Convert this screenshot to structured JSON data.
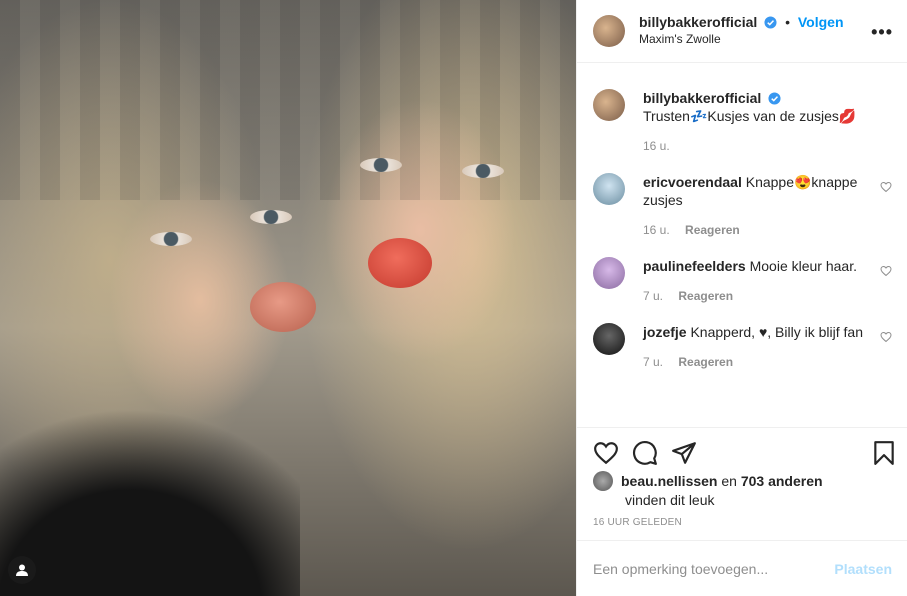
{
  "post": {
    "username": "billybakkerofficial",
    "dot": "•",
    "follow_label": "Volgen",
    "location": "Maxim's Zwolle",
    "more": "•••"
  },
  "caption": {
    "username": "billybakkerofficial",
    "text_before_emoji": "Trusten",
    "emoji_sleep": "💤",
    "text_after_emoji": "Kusjes van de zusjes",
    "emoji_kiss": "💋",
    "time": "16 u."
  },
  "comments": [
    {
      "username": "ericvoerendaal",
      "text": "Knappe😍knappe zusjes",
      "time": "16 u.",
      "reply": "Reageren"
    },
    {
      "username": "paulinefeelders",
      "text": "Mooie kleur haar.",
      "time": "7 u.",
      "reply": "Reageren"
    },
    {
      "username": "jozefje",
      "text": "Knapperd, ♥, Billy ik blijf fan",
      "time": "7 u.",
      "reply": "Reageren"
    }
  ],
  "likes": {
    "user": "beau.nellissen",
    "conj": "en",
    "count": "703 anderen",
    "suffix": "vinden dit leuk"
  },
  "timestamp": "16 UUR GELEDEN",
  "add_comment": {
    "placeholder": "Een opmerking toevoegen...",
    "post_label": "Plaatsen"
  },
  "colors": {
    "accent": "#0095f6",
    "disabled_post": "#b2dffc",
    "muted": "#8e8e8e"
  },
  "icons": [
    "heart-icon",
    "comment-icon",
    "share-icon",
    "bookmark-icon",
    "verified-icon",
    "user-tag-icon",
    "more-icon"
  ]
}
